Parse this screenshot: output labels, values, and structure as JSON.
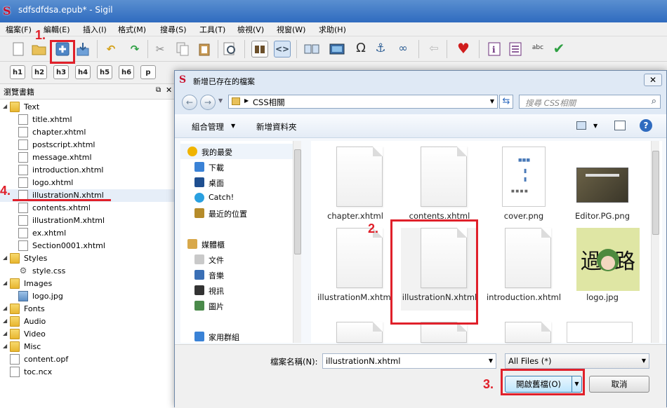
{
  "window": {
    "title": "sdfsdfdsa.epub* - Sigil"
  },
  "menu": [
    "檔案(F)",
    "編輯(E)",
    "插入(I)",
    "格式(M)",
    "搜尋(S)",
    "工具(T)",
    "檢視(V)",
    "視窗(W)",
    "求助(H)"
  ],
  "heading_buttons": [
    "h1",
    "h2",
    "h3",
    "h4",
    "h5",
    "h6",
    "p"
  ],
  "book_browser": {
    "title": "瀏覽書籍",
    "tree": [
      {
        "label": "Text",
        "type": "folder",
        "level": 0
      },
      {
        "label": "title.xhtml",
        "type": "file",
        "level": 1
      },
      {
        "label": "chapter.xhtml",
        "type": "file",
        "level": 1
      },
      {
        "label": "postscript.xhtml",
        "type": "file",
        "level": 1
      },
      {
        "label": "message.xhtml",
        "type": "file",
        "level": 1
      },
      {
        "label": "introduction.xhtml",
        "type": "file",
        "level": 1
      },
      {
        "label": "logo.xhtml",
        "type": "file",
        "level": 1
      },
      {
        "label": "illustrationN.xhtml",
        "type": "file",
        "level": 1,
        "selected": true
      },
      {
        "label": "contents.xhtml",
        "type": "file",
        "level": 1
      },
      {
        "label": "illustrationM.xhtml",
        "type": "file",
        "level": 1
      },
      {
        "label": "ex.xhtml",
        "type": "file",
        "level": 1
      },
      {
        "label": "Section0001.xhtml",
        "type": "file",
        "level": 1
      },
      {
        "label": "Styles",
        "type": "folder",
        "level": 0
      },
      {
        "label": "style.css",
        "type": "css",
        "level": 1
      },
      {
        "label": "Images",
        "type": "folder",
        "level": 0
      },
      {
        "label": "logo.jpg",
        "type": "image",
        "level": 1
      },
      {
        "label": "Fonts",
        "type": "folder",
        "level": 0
      },
      {
        "label": "Audio",
        "type": "folder",
        "level": 0
      },
      {
        "label": "Video",
        "type": "folder",
        "level": 0
      },
      {
        "label": "Misc",
        "type": "folder",
        "level": 0
      },
      {
        "label": "content.opf",
        "type": "file",
        "level": 0
      },
      {
        "label": "toc.ncx",
        "type": "file",
        "level": 0
      }
    ]
  },
  "dialog": {
    "title": "新增已存在的檔案",
    "path": "CSS相關",
    "search_placeholder": "搜尋 CSS相關",
    "organize": "組合管理",
    "new_folder": "新增資料夾",
    "nav": [
      {
        "label": "我的最愛",
        "icon": "star-icon"
      },
      {
        "label": "下載",
        "icon": "download-folder-icon"
      },
      {
        "label": "桌面",
        "icon": "desktop-icon"
      },
      {
        "label": "Catch!",
        "icon": "catch-icon"
      },
      {
        "label": "最近的位置",
        "icon": "recent-places-icon"
      },
      {
        "label": "媒體櫃",
        "icon": "library-icon"
      },
      {
        "label": "文件",
        "icon": "documents-icon"
      },
      {
        "label": "音樂",
        "icon": "music-icon"
      },
      {
        "label": "視訊",
        "icon": "video-icon"
      },
      {
        "label": "圖片",
        "icon": "pictures-icon"
      },
      {
        "label": "家用群組",
        "icon": "homegroup-icon"
      }
    ],
    "files": [
      {
        "name": "chapter.xhtml",
        "kind": "doc"
      },
      {
        "name": "contents.xhtml",
        "kind": "doc"
      },
      {
        "name": "cover.png",
        "kind": "cover"
      },
      {
        "name": "Editor.PG.png",
        "kind": "editor"
      },
      {
        "name": "illustrationM.xhtml",
        "kind": "doc"
      },
      {
        "name": "illustrationN.xhtml",
        "kind": "doc",
        "selected": true
      },
      {
        "name": "introduction.xhtml",
        "kind": "doc"
      },
      {
        "name": "logo.jpg",
        "kind": "logo"
      }
    ],
    "filename_label": "檔案名稱(N):",
    "filename_value": "illustrationN.xhtml",
    "filter": "All Files (*)",
    "open_button": "開啟舊檔(O)",
    "cancel_button": "取消"
  },
  "annotations": [
    "1.",
    "2.",
    "3.",
    "4."
  ],
  "colors": {
    "annotation": "#e0202a",
    "titlebar": "#2f6bbf"
  }
}
